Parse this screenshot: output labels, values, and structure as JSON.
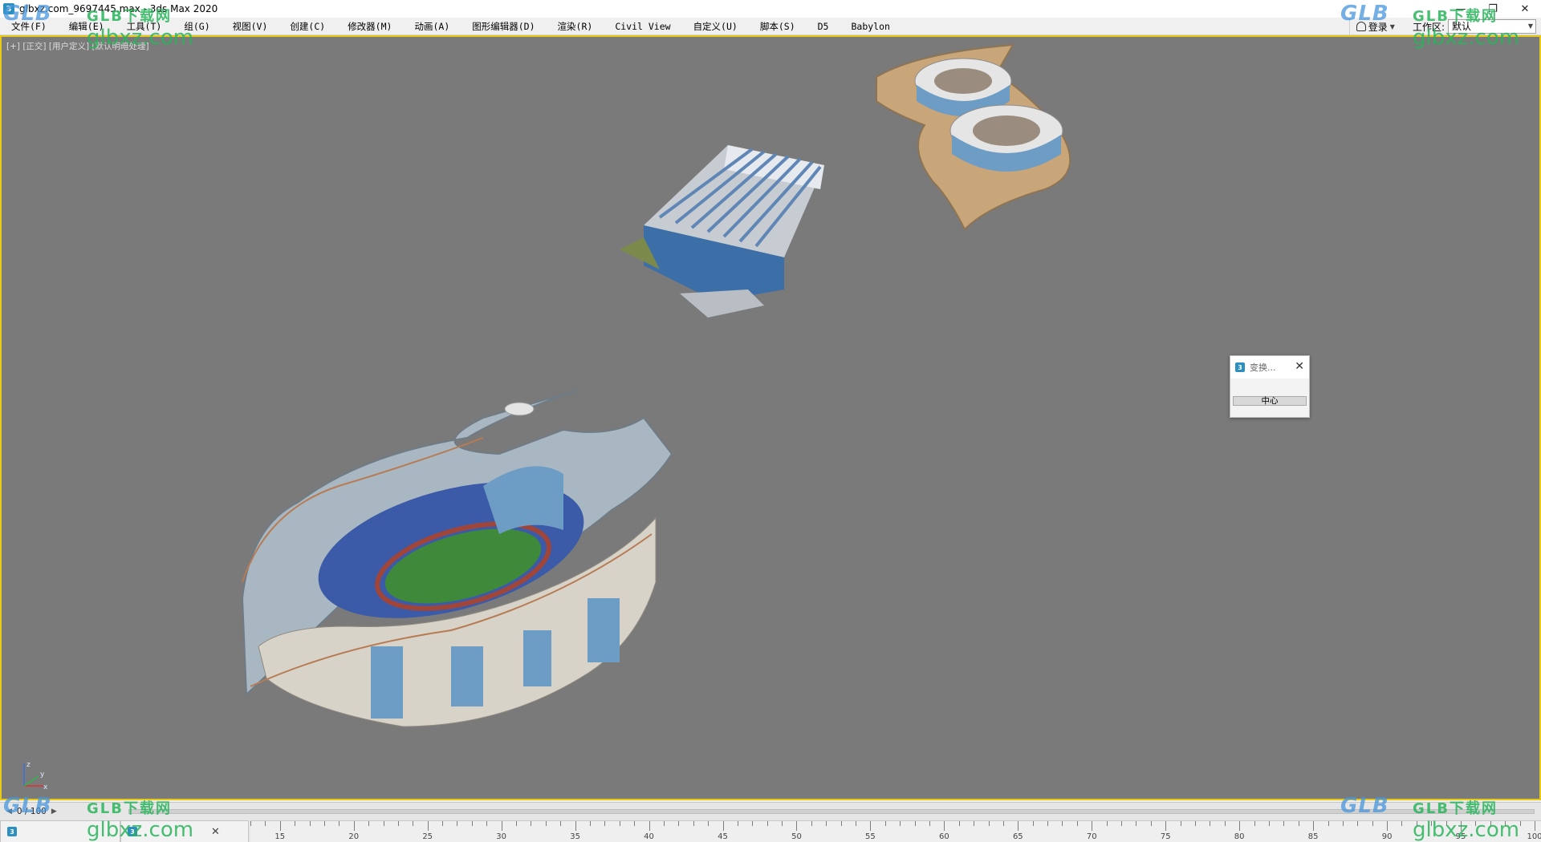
{
  "window": {
    "title": "glbxz.com_9697445.max - 3ds Max 2020",
    "app_icon": "3",
    "controls": [
      "—",
      "❐",
      "✕"
    ]
  },
  "menu": {
    "items": [
      "文件(F)",
      "编辑(E)",
      "工具(T)",
      "组(G)",
      "视图(V)",
      "创建(C)",
      "修改器(M)",
      "动画(A)",
      "图形编辑器(D)",
      "渲染(R)",
      "Civil View",
      "自定义(U)",
      "脚本(S)",
      "D5",
      "Babylon"
    ],
    "login_label": "登录",
    "workspace_label": "工作区:",
    "workspace_value": "默认"
  },
  "viewport": {
    "label": "[+] [正交] [用户定义] [默认明暗处理]",
    "axis_labels": {
      "x": "x",
      "y": "y",
      "z": "z"
    }
  },
  "dialog": {
    "icon": "3",
    "title": "变换...",
    "close": "✕",
    "button_label": "中心"
  },
  "timeline": {
    "frame_counter": "0 / 100",
    "left_arrow": "◀",
    "right_arrow": "▶",
    "ticks": [
      15,
      20,
      25,
      30,
      35,
      40,
      45,
      50,
      55,
      60,
      65,
      70,
      75,
      80,
      85,
      90,
      95,
      100
    ]
  },
  "tabs": [
    {
      "icon": "3",
      "label": "",
      "close": ""
    },
    {
      "icon": "3",
      "label": "",
      "close": "✕"
    }
  ],
  "watermark": {
    "logo": "GLB",
    "top": "GLB下载网",
    "site": "glbxz.com"
  },
  "colors": {
    "viewport_bg": "#7a7a7a",
    "viewport_border": "#e6c817",
    "roof": "#a9b7c2",
    "seat_blue": "#3b5aa8",
    "glass": "#6d9cc4",
    "pitch_green": "#3f8a3a",
    "track_red": "#a0453a",
    "plaza_tan": "#c9a67a"
  }
}
